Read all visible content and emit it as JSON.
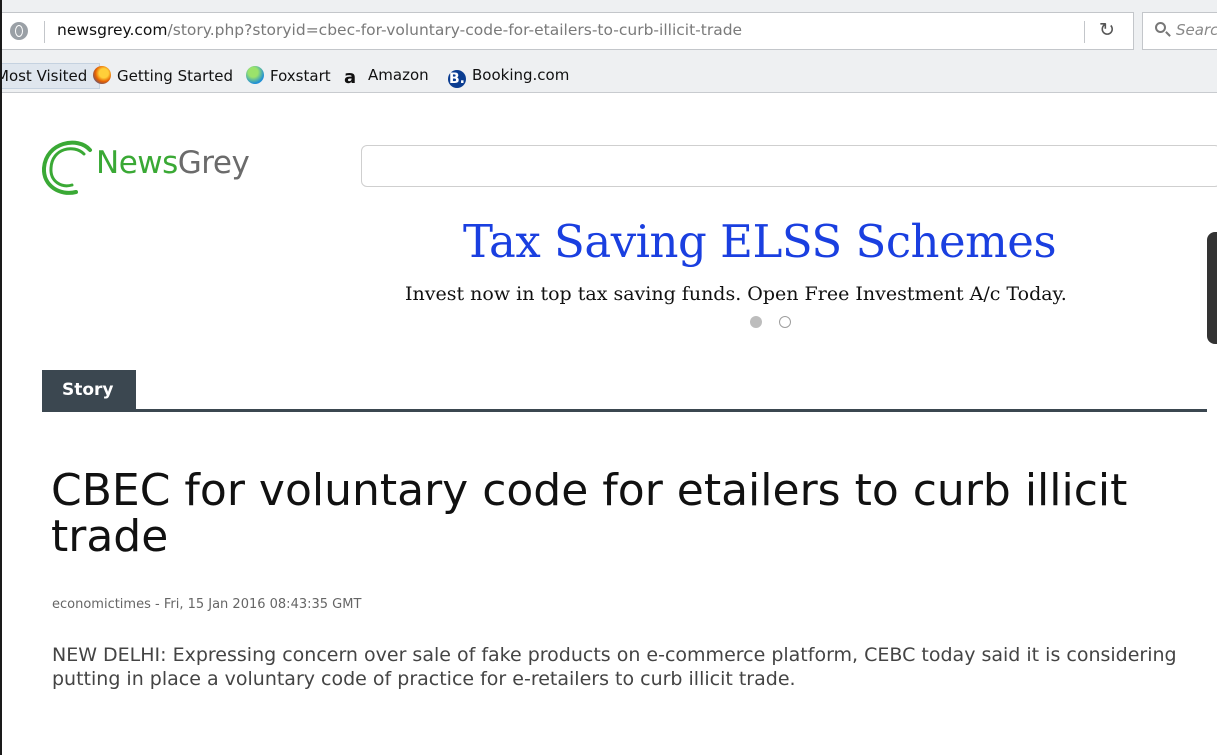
{
  "browser": {
    "url_domain": "newsgrey.com",
    "url_path": "/story.php?storyid=cbec-for-voluntary-code-for-etailers-to-curb-illicit-trade",
    "search_placeholder": "Search",
    "reload_glyph": "C"
  },
  "bookmarks": [
    {
      "label": "Most Visited",
      "icon": "none"
    },
    {
      "label": "Getting Started",
      "icon": "firefox-icon"
    },
    {
      "label": "Foxstart",
      "icon": "globe-icon"
    },
    {
      "label": "Amazon",
      "icon": "amazon-icon",
      "glyph": "a"
    },
    {
      "label": "Booking.com",
      "icon": "booking-icon",
      "glyph": "B."
    }
  ],
  "site": {
    "logo_part1": "News",
    "logo_part2": "Grey",
    "search_value": ""
  },
  "ad": {
    "title": "Tax Saving ELSS Schemes",
    "subtitle": "Invest now in top tax saving funds. Open Free Investment A/c Today.",
    "slides_total": 2,
    "active_slide": 1
  },
  "colors": {
    "logo_green": "#3aa935",
    "ad_blue": "#1a3fe0",
    "tab_dark": "#3b4750"
  },
  "tabs": [
    {
      "label": "Story"
    }
  ],
  "article": {
    "headline": "CBEC for voluntary code for etailers to curb illicit trade",
    "source": "economictimes",
    "separator": " - ",
    "date": "Fri, 15 Jan 2016 08:43:35 GMT",
    "body": "NEW DELHI: Expressing concern over sale of fake products on e-commerce platform, CEBC today said it is considering putting in place a voluntary code of practice for e-retailers to curb illicit trade."
  }
}
